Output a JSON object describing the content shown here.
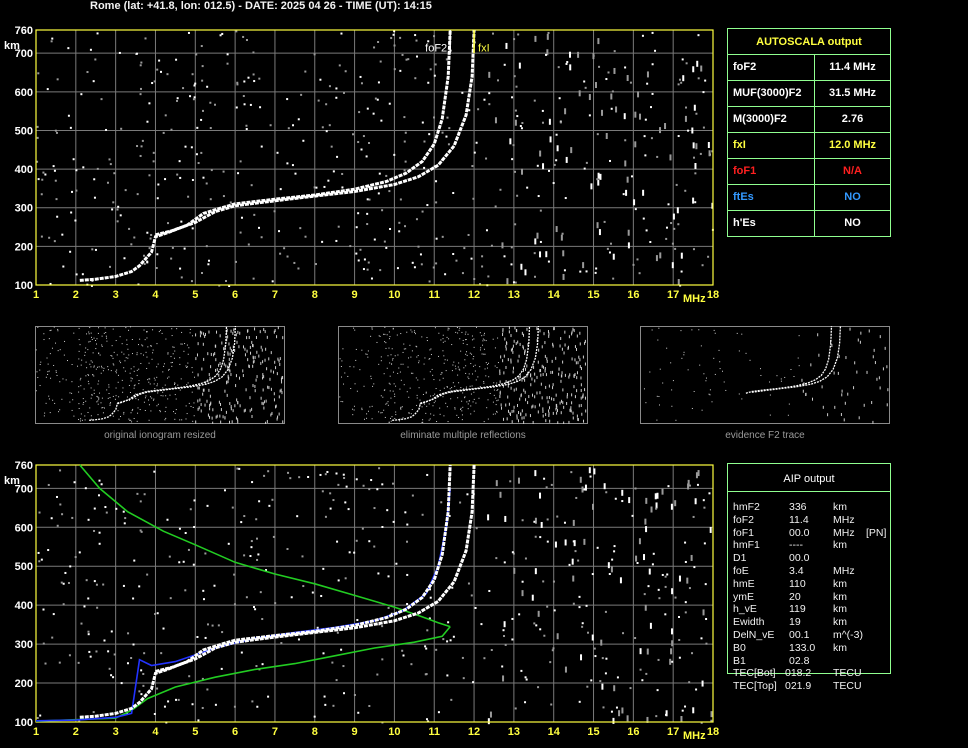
{
  "header": "Rome (lat: +41.8, lon: 012.5) - DATE: 2025 04 26 - TIME (UT): 14:15",
  "colors": {
    "axis": "#ffff40",
    "grid": "#7a7a7a",
    "panel_border": "#90ff90",
    "trace": "#ffffff",
    "model": "#22cc22",
    "profile": "#2233ff"
  },
  "autoscala": {
    "title": "AUTOSCALA output",
    "rows": [
      {
        "label": "foF2",
        "value": "11.4 MHz",
        "color": "#ffffff"
      },
      {
        "label": "MUF(3000)F2",
        "value": "31.5 MHz",
        "color": "#ffffff"
      },
      {
        "label": "M(3000)F2",
        "value": "2.76",
        "color": "#ffffff"
      },
      {
        "label": "fxI",
        "value": "12.0 MHz",
        "color": "#ffff40"
      },
      {
        "label": "foF1",
        "value": "N/A",
        "color": "#ff2020"
      },
      {
        "label": "ftEs",
        "value": "NO",
        "color": "#3399ff"
      },
      {
        "label": "h'Es",
        "value": "NO",
        "color": "#ffffff"
      }
    ]
  },
  "aip": {
    "title": "AIP output",
    "rows": [
      {
        "name": "hmF2",
        "value": "336",
        "unit": "km",
        "flag": ""
      },
      {
        "name": "foF2",
        "value": "11.4",
        "unit": "MHz",
        "flag": ""
      },
      {
        "name": "foF1",
        "value": "00.0",
        "unit": "MHz",
        "flag": "[PN]"
      },
      {
        "name": "hmF1",
        "value": "----",
        "unit": "km",
        "flag": ""
      },
      {
        "name": "D1",
        "value": "00.0",
        "unit": "",
        "flag": ""
      },
      {
        "name": "foE",
        "value": "3.4",
        "unit": "MHz",
        "flag": ""
      },
      {
        "name": "hmE",
        "value": "110",
        "unit": "km",
        "flag": ""
      },
      {
        "name": "ymE",
        "value": "20",
        "unit": "km",
        "flag": ""
      },
      {
        "name": "h_vE",
        "value": "119",
        "unit": "km",
        "flag": ""
      },
      {
        "name": "Ewidth",
        "value": "19",
        "unit": "km",
        "flag": ""
      },
      {
        "name": "DelN_vE",
        "value": "00.1",
        "unit": "m^(-3)",
        "flag": ""
      },
      {
        "name": "B0",
        "value": "133.0",
        "unit": "km",
        "flag": ""
      },
      {
        "name": "B1",
        "value": "02.8",
        "unit": "",
        "flag": ""
      },
      {
        "name": "TEC[Bot]",
        "value": "018.2",
        "unit": "TECU",
        "flag": ""
      },
      {
        "name": "TEC[Top]",
        "value": "021.9",
        "unit": "TECU",
        "flag": ""
      }
    ]
  },
  "thumbnails": [
    {
      "caption": "original ionogram resized"
    },
    {
      "caption": "eliminate multiple reflections"
    },
    {
      "caption": "evidence F2 trace"
    }
  ],
  "chart_data": [
    {
      "type": "scatter",
      "title": "",
      "xlabel": "MHz",
      "ylabel": "km",
      "xlim": [
        1,
        18
      ],
      "ylim": [
        100,
        760
      ],
      "xticks": [
        1,
        2,
        3,
        4,
        5,
        6,
        7,
        8,
        9,
        10,
        11,
        12,
        13,
        14,
        15,
        16,
        17,
        18
      ],
      "yticks": [
        100,
        200,
        300,
        400,
        500,
        600,
        700,
        760
      ],
      "grid": true,
      "annotations": [
        {
          "text": "foF2",
          "x": 11.4
        },
        {
          "text": "fxI",
          "x": 12.0
        }
      ],
      "series": [
        {
          "role": "o-trace",
          "color": "#ffffff",
          "points": [
            [
              2.1,
              112
            ],
            [
              2.5,
              115
            ],
            [
              3.0,
              122
            ],
            [
              3.4,
              135
            ],
            [
              3.6,
              150
            ],
            [
              3.9,
              185
            ],
            [
              4.0,
              225
            ],
            [
              4.3,
              235
            ],
            [
              4.8,
              255
            ],
            [
              5.2,
              285
            ],
            [
              5.6,
              298
            ],
            [
              6.0,
              310
            ],
            [
              7.0,
              322
            ],
            [
              8.0,
              333
            ],
            [
              9.0,
              348
            ],
            [
              9.8,
              368
            ],
            [
              10.3,
              390
            ],
            [
              10.7,
              420
            ],
            [
              11.0,
              465
            ],
            [
              11.2,
              530
            ],
            [
              11.35,
              640
            ],
            [
              11.4,
              760
            ]
          ]
        },
        {
          "role": "x-trace",
          "color": "#ffffff",
          "points": [
            [
              4.0,
              230
            ],
            [
              4.4,
              240
            ],
            [
              5.0,
              262
            ],
            [
              5.5,
              290
            ],
            [
              6.0,
              305
            ],
            [
              7.0,
              318
            ],
            [
              8.0,
              330
            ],
            [
              9.0,
              342
            ],
            [
              10.0,
              360
            ],
            [
              10.6,
              380
            ],
            [
              11.1,
              410
            ],
            [
              11.5,
              460
            ],
            [
              11.8,
              540
            ],
            [
              11.95,
              640
            ],
            [
              12.0,
              760
            ]
          ]
        }
      ]
    },
    {
      "type": "line",
      "title": "",
      "xlabel": "MHz",
      "ylabel": "km",
      "xlim": [
        1,
        18
      ],
      "ylim": [
        100,
        760
      ],
      "xticks": [
        1,
        2,
        3,
        4,
        5,
        6,
        7,
        8,
        9,
        10,
        11,
        12,
        13,
        14,
        15,
        16,
        17,
        18
      ],
      "yticks": [
        100,
        200,
        300,
        400,
        500,
        600,
        700,
        760
      ],
      "grid": true,
      "series": [
        {
          "role": "topside",
          "color": "#22cc22",
          "points": [
            [
              2.1,
              760
            ],
            [
              2.6,
              700
            ],
            [
              3.3,
              640
            ],
            [
              4.2,
              590
            ],
            [
              5.0,
              555
            ],
            [
              6.0,
              510
            ],
            [
              7.0,
              480
            ],
            [
              8.0,
              455
            ],
            [
              9.0,
              425
            ],
            [
              10.0,
              395
            ],
            [
              10.7,
              370
            ],
            [
              11.1,
              355
            ],
            [
              11.4,
              345
            ]
          ]
        },
        {
          "role": "bottomside",
          "color": "#22cc22",
          "points": [
            [
              11.4,
              345
            ],
            [
              11.2,
              320
            ],
            [
              10.5,
              305
            ],
            [
              9.5,
              290
            ],
            [
              8.5,
              270
            ],
            [
              7.5,
              250
            ],
            [
              6.5,
              235
            ],
            [
              5.5,
              215
            ],
            [
              4.5,
              190
            ],
            [
              3.8,
              160
            ],
            [
              3.4,
              130
            ],
            [
              3.0,
              110
            ],
            [
              2.0,
              106
            ],
            [
              1.0,
              102
            ]
          ]
        },
        {
          "role": "true-height",
          "color": "#2233ff",
          "points": [
            [
              1.0,
              103
            ],
            [
              2.0,
              105
            ],
            [
              3.0,
              112
            ],
            [
              3.4,
              122
            ],
            [
              3.6,
              260
            ],
            [
              3.9,
              245
            ],
            [
              4.5,
              255
            ],
            [
              5.5,
              290
            ],
            [
              6.5,
              315
            ],
            [
              7.5,
              330
            ],
            [
              8.5,
              343
            ],
            [
              9.5,
              360
            ],
            [
              10.2,
              385
            ],
            [
              10.8,
              430
            ],
            [
              11.1,
              500
            ],
            [
              11.3,
              600
            ],
            [
              11.4,
              700
            ]
          ]
        },
        {
          "role": "o-trace",
          "color": "#ffffff",
          "points": [
            [
              2.1,
              112
            ],
            [
              2.5,
              115
            ],
            [
              3.0,
              122
            ],
            [
              3.4,
              135
            ],
            [
              3.6,
              150
            ],
            [
              3.9,
              185
            ],
            [
              4.0,
              225
            ],
            [
              4.3,
              235
            ],
            [
              4.8,
              255
            ],
            [
              5.2,
              285
            ],
            [
              5.6,
              298
            ],
            [
              6.0,
              310
            ],
            [
              7.0,
              322
            ],
            [
              8.0,
              333
            ],
            [
              9.0,
              348
            ],
            [
              9.8,
              368
            ],
            [
              10.3,
              390
            ],
            [
              10.7,
              420
            ],
            [
              11.0,
              465
            ],
            [
              11.2,
              530
            ],
            [
              11.35,
              640
            ],
            [
              11.4,
              760
            ]
          ]
        },
        {
          "role": "x-trace",
          "color": "#ffffff",
          "points": [
            [
              4.0,
              230
            ],
            [
              4.4,
              240
            ],
            [
              5.0,
              262
            ],
            [
              5.5,
              290
            ],
            [
              6.0,
              305
            ],
            [
              7.0,
              318
            ],
            [
              8.0,
              330
            ],
            [
              9.0,
              342
            ],
            [
              10.0,
              360
            ],
            [
              10.6,
              380
            ],
            [
              11.1,
              410
            ],
            [
              11.5,
              460
            ],
            [
              11.8,
              540
            ],
            [
              11.95,
              640
            ],
            [
              12.0,
              760
            ]
          ]
        }
      ]
    }
  ]
}
